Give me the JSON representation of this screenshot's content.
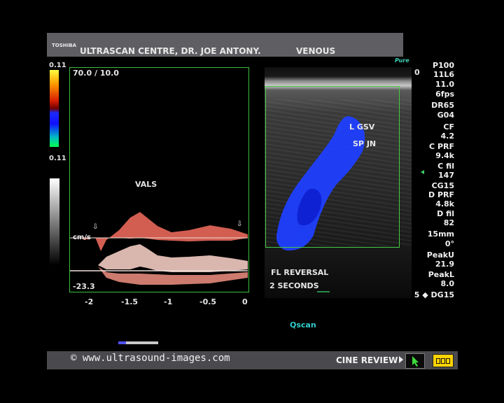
{
  "header": {
    "brand": "TOSHIBA",
    "clinic": "ULTRASCAN CENTRE, DR. JOE ANTONY.",
    "preset": "VENOUS"
  },
  "color_scale": {
    "top": "0.11",
    "bottom": "0.11"
  },
  "doppler": {
    "scale_text": "70.0 / 10.0",
    "label": "VALS",
    "unit": "cm/s",
    "min_value": "-23.3",
    "x_ticks": [
      "-2",
      "-1.5",
      "-1",
      "-0.5",
      "0"
    ]
  },
  "image_panel": {
    "vessel_label": "L GSV",
    "junction_label": "SP JN",
    "logo": "Pure",
    "depth_zero": "0"
  },
  "annotations": {
    "line1": "FL REVERSAL",
    "line2": "2 SECONDS",
    "qscan": "Qscan"
  },
  "params": [
    "P100",
    "11L6",
    "11.0",
    "6fps",
    "DR65",
    "G04",
    "CF",
    "4.2",
    "C PRF",
    "9.4k",
    "C fil",
    "147",
    "CG15",
    "D PRF",
    "4.8k",
    "D fil",
    "82",
    "15mm",
    "0°",
    "PeakU",
    "21.9",
    "PeakL",
    "8.0"
  ],
  "param_last": "DG15",
  "param_last_prefix": "5",
  "footer": {
    "copyright": "© www.ultrasound-images.com",
    "cine_review": "CINE REVIEW"
  },
  "colors": {
    "background": "#000000",
    "bar": "#5f5f63",
    "roi_border": "#44cc44",
    "flow": "#1a3cff",
    "spectral": "#ff8070",
    "cine_button": "#ffd400"
  }
}
